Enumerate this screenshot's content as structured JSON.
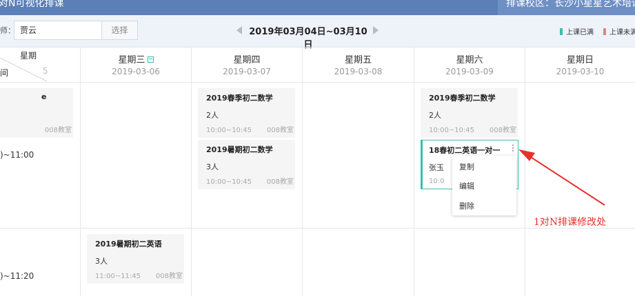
{
  "header": {
    "title_fragment": "对N可视化排课",
    "campus_fragment": "排课校区：长沙小星星艺术培训学校"
  },
  "toolbar": {
    "teacher_label_fragment": "师：",
    "teacher_value": "贾云",
    "select_label": "选择",
    "week_range": "2019年03月04日~03月10日",
    "legend": [
      {
        "label": "上课已满",
        "color": "#37c0aa"
      },
      {
        "label": "上课未满",
        "color": "#f27a8a"
      }
    ]
  },
  "grid": {
    "corner_week": "星期",
    "corner_time_fragment": "间",
    "partial_date_fragment": "5",
    "days": [
      {
        "weekday": "星期三",
        "date": "2019-03-06",
        "today_icon": "calendar-icon"
      },
      {
        "weekday": "星期四",
        "date": "2019-03-07"
      },
      {
        "weekday": "星期五",
        "date": "2019-03-08"
      },
      {
        "weekday": "星期六",
        "date": "2019-03-09"
      },
      {
        "weekday": "星期日",
        "date": "2019-03-10"
      }
    ],
    "time_rows": [
      {
        "label_fragment": ")~11:00"
      },
      {
        "label_fragment": ")~11:20"
      }
    ]
  },
  "cards": {
    "partial_mon": {
      "name_fragment": "e",
      "room": "008教室"
    },
    "thu_1": {
      "name": "2019春季初二数学",
      "count": "2人",
      "time": "10:00~10:45",
      "room": "008教室"
    },
    "thu_2": {
      "name": "2019暑期初二数学",
      "count": "3人",
      "time": "10:00~10:45",
      "room": "008教室"
    },
    "sat_1": {
      "name": "2019春季初二数学",
      "count": "2人",
      "time": "10:00~10:45",
      "room": "008教室"
    },
    "sat_2": {
      "name": "18春初二英语一对一",
      "teacher_fragment": "张玉",
      "time_fragment": "10:0"
    },
    "wed_1": {
      "name": "2019暑期初二英语",
      "count": "3人",
      "time": "11:00~11:45",
      "room": "008教室"
    }
  },
  "context_menu": {
    "items": [
      "复制",
      "编辑",
      "删除"
    ]
  },
  "annotation": {
    "text": "1对N排课修改处",
    "color": "#e5322d"
  }
}
